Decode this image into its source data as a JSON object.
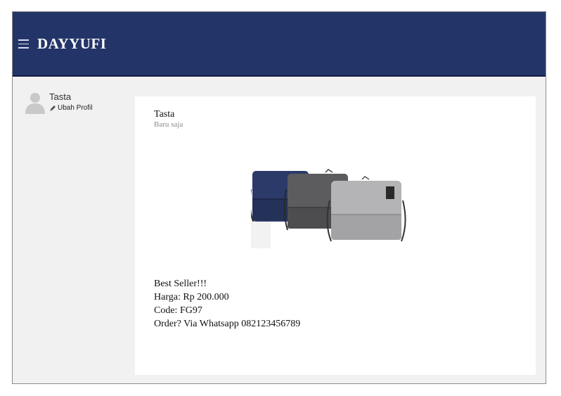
{
  "header": {
    "menu_icon": "hamburger-icon",
    "brand": "DAYYUFI",
    "background": "#233468"
  },
  "sidebar": {
    "user_name": "Tasta",
    "edit_profile_label": "Ubah Profil",
    "avatar_icon": "user-silhouette-icon",
    "edit_icon": "pencil-icon"
  },
  "post": {
    "author": "Tasta",
    "time": "Baru saja",
    "lines": [
      "Best Seller!!!",
      "Harga: Rp 200.000",
      "Code: FG97",
      "Order? Via Whatsapp 082123456789"
    ]
  }
}
